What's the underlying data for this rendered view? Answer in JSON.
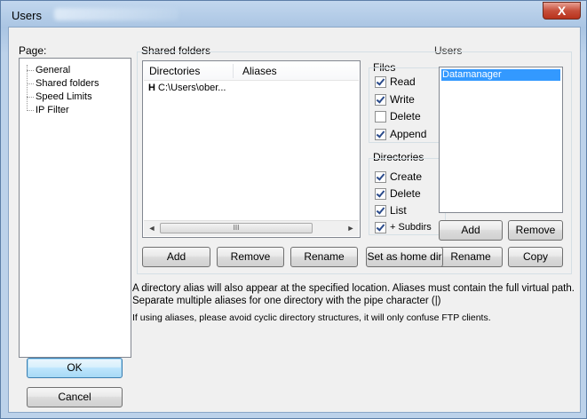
{
  "window": {
    "title": "Users",
    "close_symbol": "X"
  },
  "page_panel": {
    "label": "Page:",
    "items": [
      "General",
      "Shared folders",
      "Speed Limits",
      "IP Filter"
    ]
  },
  "shared_folders": {
    "group_label": "Shared folders",
    "columns": [
      "Directories",
      "Aliases"
    ],
    "rows": [
      {
        "flag": "H",
        "directory": "C:\\Users\\ober...",
        "alias": ""
      }
    ],
    "scroll_left": "◄",
    "scroll_right": "►",
    "scroll_thumb": "III",
    "buttons": {
      "add": "Add",
      "remove": "Remove",
      "rename": "Rename",
      "set_home": "Set as home dir"
    }
  },
  "files": {
    "label": "Files",
    "read": {
      "label": "Read",
      "checked": true
    },
    "write": {
      "label": "Write",
      "checked": true
    },
    "delete": {
      "label": "Delete",
      "checked": false
    },
    "append": {
      "label": "Append",
      "checked": true
    }
  },
  "directories": {
    "label": "Directories",
    "create": {
      "label": "Create",
      "checked": true
    },
    "delete": {
      "label": "Delete",
      "checked": true
    },
    "list": {
      "label": "List",
      "checked": true
    },
    "subdirs": {
      "label": "+ Subdirs",
      "checked": true
    }
  },
  "users": {
    "label": "Users",
    "items": [
      "Datamanager"
    ],
    "selected": "Datamanager",
    "buttons": {
      "add": "Add",
      "remove": "Remove",
      "rename": "Rename",
      "copy": "Copy"
    }
  },
  "info": {
    "line1": "A directory alias will also appear at the specified location. Aliases must contain the full virtual path.",
    "line2": "Separate multiple aliases for one directory with the pipe character (|)",
    "line3": "If using aliases, please avoid cyclic directory structures, it will only confuse FTP clients."
  },
  "dialog_buttons": {
    "ok": "OK",
    "cancel": "Cancel"
  }
}
